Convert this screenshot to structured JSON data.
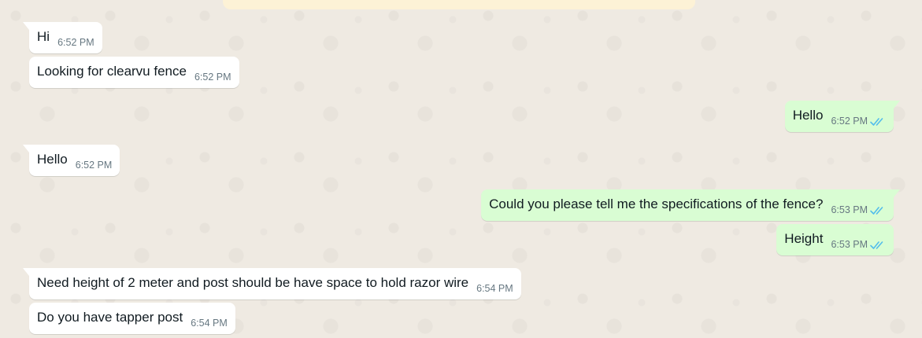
{
  "colors": {
    "wallpaper": "#efeae2",
    "incoming_bubble": "#ffffff",
    "outgoing_bubble": "#d9fdd3",
    "read_ticks": "#53bdeb",
    "banner": "#fdf2d6"
  },
  "messages": [
    {
      "direction": "incoming",
      "text": "Hi",
      "time": "6:52 PM"
    },
    {
      "direction": "incoming",
      "text": "Looking for clearvu fence",
      "time": "6:52 PM"
    },
    {
      "direction": "outgoing",
      "text": "Hello",
      "time": "6:52 PM",
      "status": "read",
      "status_icon": "double-check-icon"
    },
    {
      "direction": "incoming",
      "text": "Hello",
      "time": "6:52 PM"
    },
    {
      "direction": "outgoing",
      "text": "Could you please tell me the specifications of the fence?",
      "time": "6:53 PM",
      "status": "read",
      "status_icon": "double-check-icon"
    },
    {
      "direction": "outgoing",
      "text": "Height",
      "time": "6:53 PM",
      "status": "read",
      "status_icon": "double-check-icon"
    },
    {
      "direction": "incoming",
      "text": "Need height of 2 meter and post should be have space to hold razor wire",
      "time": "6:54 PM"
    },
    {
      "direction": "incoming",
      "text": "Do you have tapper post",
      "time": "6:54 PM"
    }
  ]
}
